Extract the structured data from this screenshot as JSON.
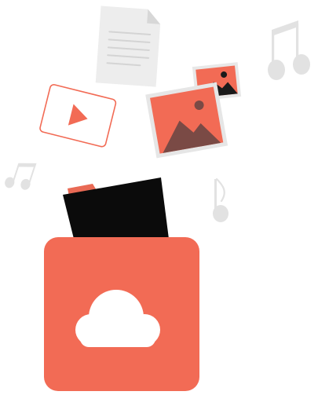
{
  "illustration": {
    "icons": [
      "document-icon",
      "double-music-note-icon",
      "small-double-music-note-icon",
      "single-music-note-icon",
      "video-play-icon",
      "small-image-icon",
      "large-image-icon",
      "folder-icon",
      "cloud-box-icon",
      "cloud-icon"
    ],
    "colors": {
      "accent": "#F26B55",
      "accent_dark": "#7A4A45",
      "folder_tab": "#E96A55",
      "folder_black": "#0B0B0B",
      "light_gray": "#E3E3E3",
      "paper": "#EFEFEF",
      "white": "#FFFFFF"
    }
  }
}
